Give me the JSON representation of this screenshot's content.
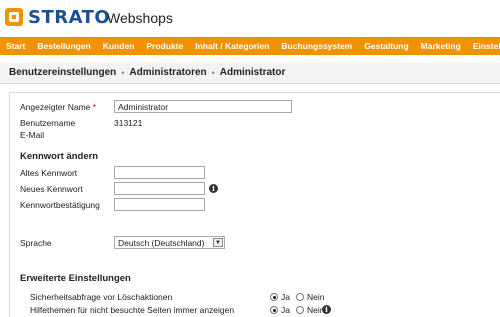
{
  "header": {
    "brand": "STRATO",
    "product": "Webshops"
  },
  "nav": {
    "items": [
      "Start",
      "Bestellungen",
      "Kunden",
      "Produkte",
      "Inhalt / Kategorien",
      "Buchungssystem",
      "Gestaltung",
      "Marketing",
      "Einstellungen"
    ]
  },
  "breadcrumb": {
    "items": [
      "Benutzereinstellungen",
      "Administratoren",
      "Administrator"
    ]
  },
  "form": {
    "display_name_label": "Angezeigter Name",
    "required_marker": "*",
    "display_name_value": "Administrator",
    "username_label": "Benutzername",
    "username_value": "313121",
    "email_label": "E-Mail",
    "password_heading": "Kennwort ändern",
    "old_password_label": "Altes Kennwort",
    "new_password_label": "Neues Kennwort",
    "confirm_password_label": "Kennwortbestätigung",
    "language_label": "Sprache",
    "language_value": "Deutsch (Deutschland)",
    "advanced_heading": "Erweiterte Einstellungen",
    "delete_confirm_label": "Sicherheitsabfrage vor Löschaktionen",
    "help_topics_label": "Hilfethemen für nicht besuchte Seiten immer anzeigen",
    "yes_label": "Ja",
    "no_label": "Nein",
    "delete_confirm_value": "Ja",
    "help_topics_value": "Ja"
  },
  "colors": {
    "accent": "#f39200",
    "brand_blue": "#1a5196"
  }
}
